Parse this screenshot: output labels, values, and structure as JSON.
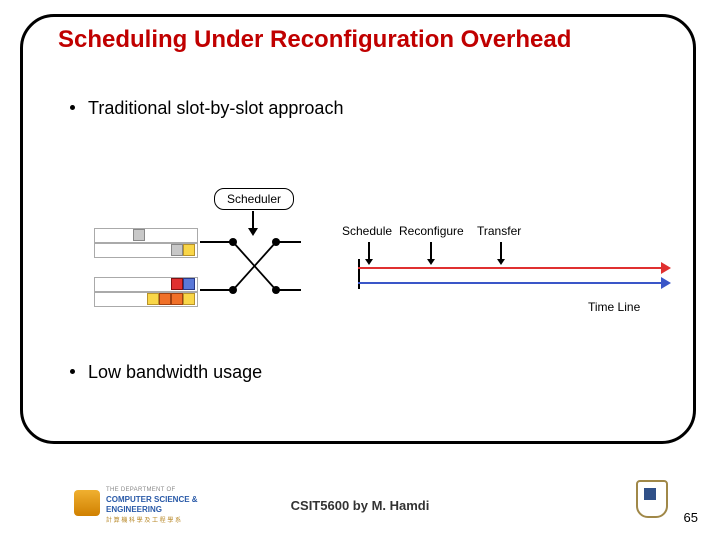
{
  "title": "Scheduling Under Reconfiguration Overhead",
  "bullets": {
    "b1": "Traditional slot-by-slot approach",
    "b2": "Low bandwidth usage"
  },
  "scheduler_label": "Scheduler",
  "timeline": {
    "schedule": "Schedule",
    "reconfigure": "Reconfigure",
    "transfer": "Transfer",
    "axis_label": "Time Line"
  },
  "footer": {
    "course": "CSIT5600 by M. Hamdi",
    "page": "65",
    "dept_line1": "THE DEPARTMENT OF",
    "dept_line2": "COMPUTER SCIENCE &",
    "dept_line3": "ENGINEERING",
    "dept_cn": "計 算 機 科 學 及 工 程 學 系"
  }
}
